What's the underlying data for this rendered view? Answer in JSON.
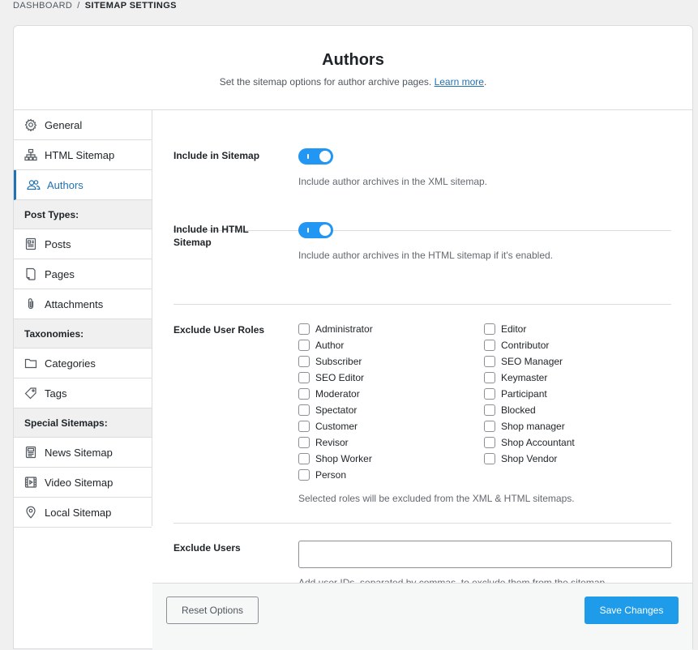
{
  "breadcrumb": {
    "root": "DASHBOARD",
    "separator": "/",
    "current": "SITEMAP SETTINGS"
  },
  "header": {
    "title": "Authors",
    "subtitle": "Set the sitemap options for author archive pages.",
    "learn_more": "Learn more",
    "period": "."
  },
  "sidebar": {
    "items": [
      {
        "label": "General",
        "icon": "gear-icon"
      },
      {
        "label": "HTML Sitemap",
        "icon": "sitemap-icon"
      },
      {
        "label": "Authors",
        "icon": "users-icon",
        "active": true
      }
    ],
    "post_types_heading": "Post Types:",
    "post_types": [
      {
        "label": "Posts",
        "icon": "document-icon"
      },
      {
        "label": "Pages",
        "icon": "page-icon"
      },
      {
        "label": "Attachments",
        "icon": "paperclip-icon"
      }
    ],
    "taxonomies_heading": "Taxonomies:",
    "taxonomies": [
      {
        "label": "Categories",
        "icon": "folder-icon"
      },
      {
        "label": "Tags",
        "icon": "tag-icon"
      }
    ],
    "special_heading": "Special Sitemaps:",
    "special": [
      {
        "label": "News Sitemap",
        "icon": "news-icon"
      },
      {
        "label": "Video Sitemap",
        "icon": "video-icon"
      },
      {
        "label": "Local Sitemap",
        "icon": "location-pin-icon"
      }
    ]
  },
  "settings": {
    "include_sitemap": {
      "label": "Include in Sitemap",
      "enabled": true,
      "description": "Include author archives in the XML sitemap."
    },
    "include_html": {
      "label_line1": "Include in HTML",
      "label_line2": "Sitemap",
      "enabled": true,
      "description": "Include author archives in the HTML sitemap if it's enabled."
    },
    "exclude_roles": {
      "label": "Exclude User Roles",
      "left": [
        "Administrator",
        "Author",
        "Subscriber",
        "SEO Editor",
        "Moderator",
        "Spectator",
        "Customer",
        "Revisor",
        "Shop Worker",
        "Person"
      ],
      "right": [
        "Editor",
        "Contributor",
        "SEO Manager",
        "Keymaster",
        "Participant",
        "Blocked",
        "Shop manager",
        "Shop Accountant",
        "Shop Vendor"
      ],
      "description": "Selected roles will be excluded from the XML & HTML sitemaps."
    },
    "exclude_users": {
      "label": "Exclude Users",
      "value": "",
      "description": "Add user IDs, separated by commas, to exclude them from the sitemap."
    }
  },
  "footer": {
    "reset_label": "Reset Options",
    "save_label": "Save Changes"
  },
  "colors": {
    "accent": "#2271b1",
    "toggle": "#2196f3",
    "save_button": "#1e9be9"
  }
}
